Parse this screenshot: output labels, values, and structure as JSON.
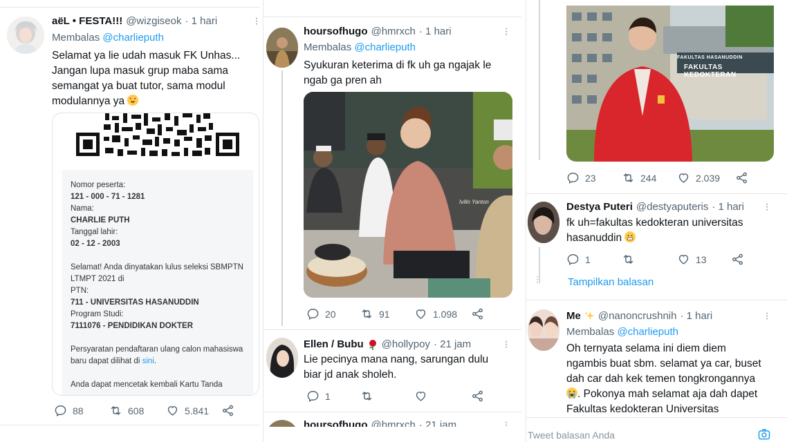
{
  "panel1": {
    "tweet": {
      "name": "aëL • FESTA!!!",
      "handle": "@wizgiseok",
      "time": "· 1 hari",
      "reply_prefix": "Membalas",
      "reply_handle": "@charlieputh",
      "text": "Selamat ya lie udah masuk FK Unhas... Jangan lupa masuk grup maba sama semangat ya buat tutor, sama modul modulannya ya",
      "emoji": "heart-eyes"
    },
    "card": {
      "nomor_label": "Nomor peserta:",
      "nomor_value": "121 - 000 - 71 - 1281",
      "nama_label": "Nama:",
      "nama_value": "CHARLIE PUTH",
      "tgl_label": "Tanggal lahir:",
      "tgl_value": "02 - 12 - 2003",
      "selamat": "Selamat! Anda dinyatakan lulus seleksi SBMPTN LTMPT 2021 di",
      "ptn_label": "PTN:",
      "ptn_value": "711 - UNIVERSITAS HASANUDDIN",
      "prodi_label": "Program Studi:",
      "prodi_value": "7111076 - PENDIDIKAN DOKTER",
      "persyaratan": "Persyaratan pendaftaran ulang calon mahasiswa baru dapat dilihat di",
      "persyaratan_link": "sini",
      "cetak": "Anda dapat mencetak kembali Kartu Tanda"
    },
    "actions": {
      "replies": "88",
      "retweets": "608",
      "likes": "5.841"
    }
  },
  "panel2": {
    "tweet1": {
      "name": "hoursofhugo",
      "handle": "@hmrxch",
      "time": "· 1 hari",
      "reply_prefix": "Membalas",
      "reply_handle": "@charlieputh",
      "text": "Syukuran keterima di fk uh ga ngajak le ngab ga pren ah",
      "photo_watermark": "Ivilin Yanton",
      "actions": {
        "replies": "20",
        "retweets": "91",
        "likes": "1.098"
      }
    },
    "tweet2": {
      "name": "Ellen / Bubu",
      "handle": "@hollypoy",
      "time": "· 21 jam",
      "text": "Lie pecinya mana nang, sarungan dulu biar jd anak sholeh.",
      "actions": {
        "replies": "1",
        "retweets": "",
        "likes": ""
      }
    },
    "tweet3": {
      "name": "hoursofhugo",
      "handle": "@hmrxch",
      "time": "· 21 jam"
    }
  },
  "panel3": {
    "photo_sign_line1": "FAKULTAS HASANUDDIN",
    "photo_sign_line2": "FAKULTAS KEDOKTERAN",
    "top_actions": {
      "replies": "23",
      "retweets": "244",
      "likes": "2.039"
    },
    "tweet1": {
      "name": "Destya Puteri",
      "handle": "@destyaputeris",
      "time": "· 1 hari",
      "text": "fk uh=fakultas kedokteran universitas hasanuddin",
      "actions": {
        "replies": "1",
        "retweets": "",
        "likes": "13"
      },
      "show_replies": "Tampilkan balasan"
    },
    "tweet2": {
      "name": "Me",
      "handle": "@nanoncrushnih",
      "time": "· 1 hari",
      "reply_prefix": "Membalas",
      "reply_handle": "@charlieputh",
      "text1": "Oh ternyata selama ini diem diem ngambis buat sbm. selamat ya car, buset dah car dah kek temen tongkrongannya",
      "text2": ". Pokonya mah selamat aja dah dapet Fakultas kedokteran Universitas"
    },
    "reply_placeholder": "Tweet balasan Anda"
  },
  "colors": {
    "accent": "#1d9bf0",
    "muted": "#536471",
    "jacket_red": "#d8262c"
  }
}
